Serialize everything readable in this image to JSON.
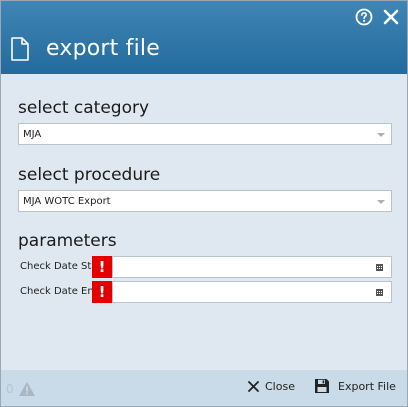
{
  "dialog": {
    "title": "export file",
    "icons": {
      "help": "help-circle-icon",
      "close": "close-icon",
      "file": "file-icon"
    }
  },
  "category": {
    "label": "select category",
    "selected": "MJA"
  },
  "procedure": {
    "label": "select procedure",
    "selected": "MJA WOTC Export"
  },
  "parameters": {
    "label": "parameters",
    "items": [
      {
        "label": "Check Date Start",
        "value": "",
        "warning": "!"
      },
      {
        "label": "Check Date End",
        "value": "",
        "warning": "!"
      }
    ]
  },
  "footer": {
    "warning_count": "0",
    "close_label": "Close",
    "export_label": "Export File"
  },
  "colors": {
    "header": "#2f78a9",
    "body": "#dfe8f0",
    "footer": "#c9dae8",
    "warning": "#e40000"
  }
}
